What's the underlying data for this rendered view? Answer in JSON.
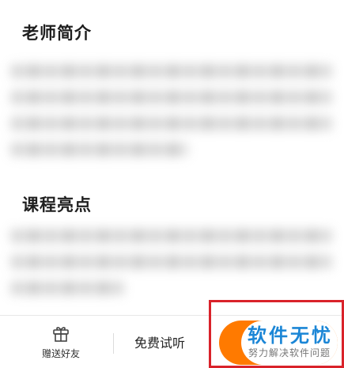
{
  "sections": {
    "teacher_intro": {
      "title": "老师简介"
    },
    "course_highlights": {
      "title": "课程亮点"
    }
  },
  "bottom_bar": {
    "gift": {
      "label": "赠送好友",
      "icon": "gift-icon"
    },
    "free_trial": {
      "label": "免费试听"
    },
    "purchase": {
      "color": "#ff7a00"
    }
  },
  "watermark": {
    "title": "软件无忧",
    "subtitle": "努力解决软件问题",
    "box_color": "#d9222a",
    "title_color": "#1b86d6"
  }
}
